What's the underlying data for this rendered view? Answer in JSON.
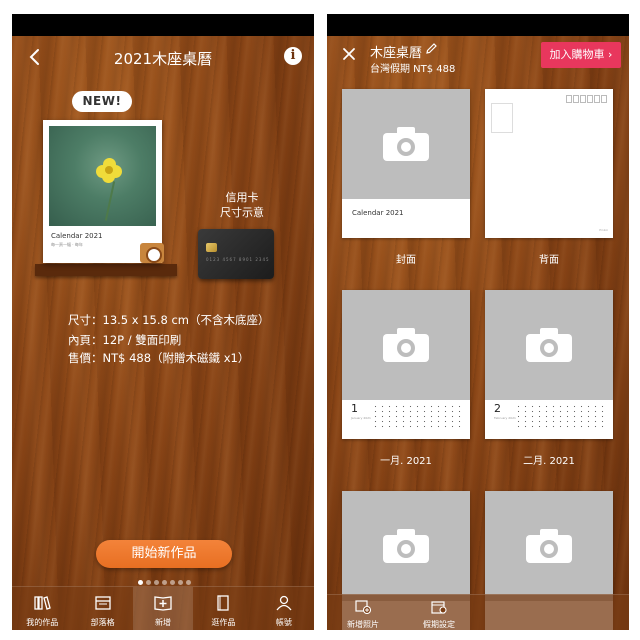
{
  "left": {
    "title": "2021木座桌曆",
    "new_badge": "NEW!",
    "product_card": {
      "label": "Calendar 2021",
      "sub": "每一頁一幅 · 每年"
    },
    "credit_card_label": "信用卡\n尺寸示意",
    "credit_card_number": "0123 4567 8901 2345",
    "specs": [
      "尺寸：13.5 x 15.8 cm（不含木底座）",
      "內頁：12P / 雙面印刷",
      "售價：NT$ 488（附贈木磁鐵 x1）"
    ],
    "start_button": "開始新作品",
    "carousel": {
      "count": 7,
      "active": 0
    },
    "tabs": [
      {
        "label": "我的作品",
        "icon": "books-icon"
      },
      {
        "label": "部落格",
        "icon": "blog-icon"
      },
      {
        "label": "新增",
        "icon": "add-book-icon",
        "active": true
      },
      {
        "label": "逛作品",
        "icon": "browse-icon"
      },
      {
        "label": "帳號",
        "icon": "person-icon"
      }
    ]
  },
  "right": {
    "title": "木座桌曆",
    "price_line": "台灣假期 NT$ 488",
    "cart_button": "加入購物車 ›",
    "pages": [
      {
        "label": "封面",
        "caption": "Calendar 2021"
      },
      {
        "label": "背面"
      },
      {
        "label": "一月. 2021",
        "month_num": "1",
        "month_sub": "January 2021"
      },
      {
        "label": "二月. 2021",
        "month_num": "2",
        "month_sub": "February 2021"
      },
      {
        "label": ""
      },
      {
        "label": ""
      }
    ],
    "bottom_tabs": [
      {
        "label": "新增照片",
        "icon": "add-photo-icon"
      },
      {
        "label": "假期設定",
        "icon": "calendar-settings-icon"
      }
    ]
  },
  "colors": {
    "wood": "#7a3d14",
    "accent_orange": "#e86f22",
    "cart_pink": "#e8375d",
    "placeholder_gray": "#bdbdbd"
  }
}
